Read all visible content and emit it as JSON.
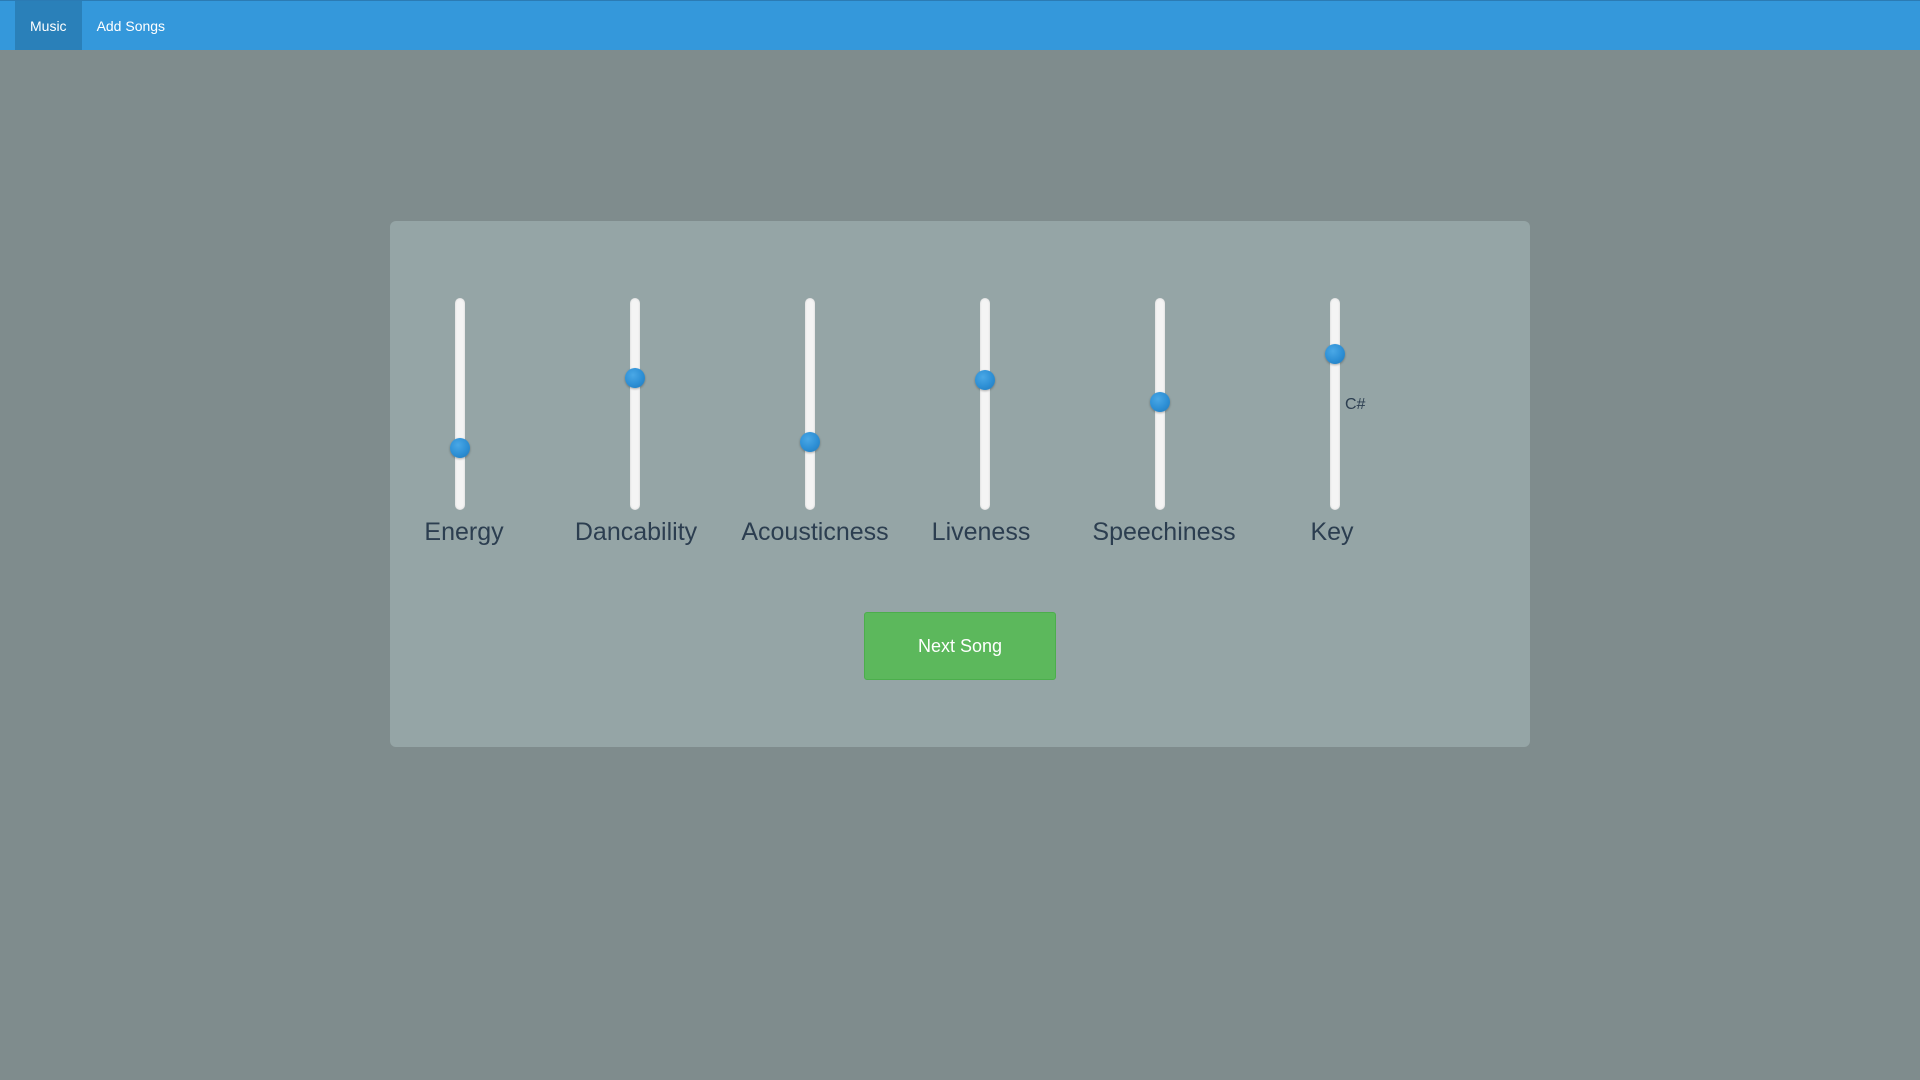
{
  "nav": {
    "items": [
      {
        "label": "Music",
        "active": true
      },
      {
        "label": "Add Songs",
        "active": false
      }
    ],
    "color": "#3498db",
    "active_color": "#2a80b9"
  },
  "sliders": [
    {
      "label": "Energy",
      "value": 0.28
    },
    {
      "label": "Dancability",
      "value": 0.63
    },
    {
      "label": "Acousticness",
      "value": 0.31
    },
    {
      "label": "Liveness",
      "value": 0.62
    },
    {
      "label": "Speechiness",
      "value": 0.51
    },
    {
      "label": "Key",
      "value": 0.75,
      "value_label": "C#"
    }
  ],
  "actions": {
    "next_song_label": "Next Song",
    "button_color": "#5cb85c"
  },
  "colors": {
    "background": "#7f8c8d",
    "panel": "#95a5a6",
    "thumb": "#2d8fd5",
    "track": "#f4f4f4"
  }
}
